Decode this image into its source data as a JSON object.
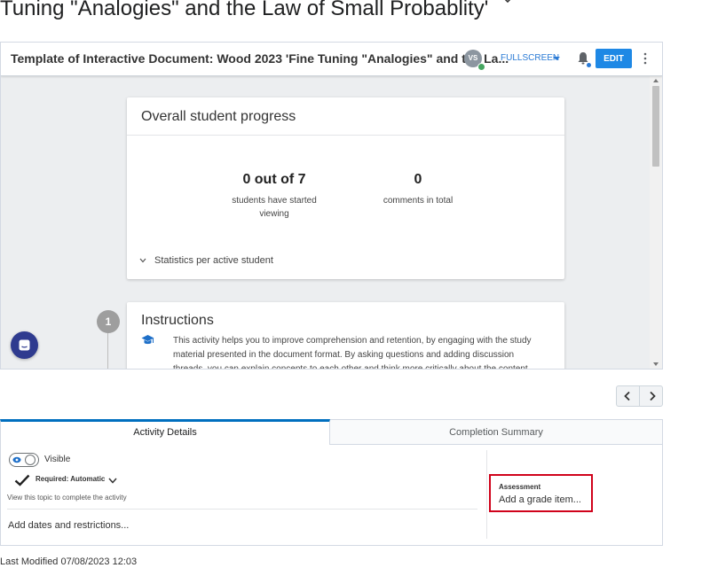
{
  "page": {
    "title": "Tuning \"Analogies\" and the Law of Small Probablity'"
  },
  "frame": {
    "doc_title": "Template of Interactive Document: Wood 2023 'Fine Tuning \"Analogies\" and the La...",
    "avatar_initials": "VS",
    "fullscreen_label": "FULLSCREEN",
    "edit_label": "EDIT",
    "accent_color": "#1e88e5"
  },
  "progress": {
    "heading": "Overall student progress",
    "started_value": "0 out of 7",
    "started_label": "students have started viewing",
    "comments_value": "0",
    "comments_label": "comments in total",
    "stats_toggle": "Statistics per active student"
  },
  "instructions": {
    "step_number": "1",
    "heading": "Instructions",
    "text": "This activity helps you to improve comprehension and retention, by engaging with the study material presented in the document format. By asking questions and adding discussion threads, you can explain concepts to each other and think more critically about the content."
  },
  "tabs": [
    {
      "label": "Activity Details",
      "active": true
    },
    {
      "label": "Completion Summary",
      "active": false
    }
  ],
  "details": {
    "visibility_label": "Visible",
    "required_label": "Required: Automatic",
    "view_topic_text": "View this topic to complete the activity",
    "dates_link": "Add dates and restrictions...",
    "assessment_label": "Assessment",
    "grade_link": "Add a grade item...",
    "highlight_color": "#d0021b"
  },
  "footer": {
    "last_modified": "Last Modified 07/08/2023 12:03"
  }
}
